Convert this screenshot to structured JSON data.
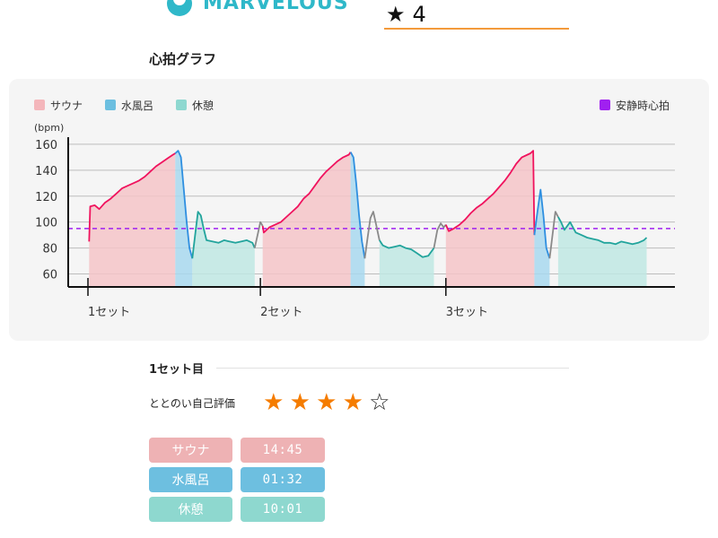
{
  "header": {
    "brand": "MARVELOUS",
    "rating_value": "4",
    "colors": {
      "brand": "#2fb8c9",
      "rating_underline": "#f39a3b"
    }
  },
  "graph_title": "心拍グラフ",
  "chart_data": {
    "type": "area",
    "ylabel": "(bpm)",
    "ylim": [
      50,
      162
    ],
    "yticks": [
      60,
      80,
      100,
      120,
      140,
      160
    ],
    "grid": true,
    "x_range": [
      0,
      100
    ],
    "set_labels": [
      {
        "x": 0,
        "label": "1セット"
      },
      {
        "x": 30.4,
        "label": "2セット"
      },
      {
        "x": 63.1,
        "label": "3セット"
      }
    ],
    "legend": [
      {
        "name": "サウナ",
        "color": "#f4b6bb"
      },
      {
        "name": "水風呂",
        "color": "#6cbfe0"
      },
      {
        "name": "休憩",
        "color": "#8ed8d0"
      }
    ],
    "resting_hr": {
      "name": "安静時心拍",
      "value": 95,
      "color": "#a020f0"
    },
    "segments": [
      {
        "phase": "sauna",
        "points": [
          [
            0.2,
            85
          ],
          [
            0.4,
            112
          ],
          [
            1.2,
            113
          ],
          [
            2,
            110
          ],
          [
            3,
            115
          ],
          [
            4,
            118
          ],
          [
            5,
            122
          ],
          [
            6,
            126
          ],
          [
            7,
            128
          ],
          [
            8,
            130
          ],
          [
            9,
            132
          ],
          [
            10,
            135
          ],
          [
            11,
            139
          ],
          [
            12,
            143
          ],
          [
            13,
            146
          ],
          [
            14,
            149
          ],
          [
            15,
            152
          ],
          [
            15.4,
            153
          ]
        ]
      },
      {
        "phase": "cold",
        "points": [
          [
            15.4,
            153
          ],
          [
            15.9,
            155
          ],
          [
            16.4,
            150
          ],
          [
            16.9,
            125
          ],
          [
            17.4,
            100
          ],
          [
            17.9,
            80
          ],
          [
            18.4,
            72
          ]
        ]
      },
      {
        "phase": "rest",
        "points": [
          [
            18.4,
            72
          ],
          [
            18.9,
            90
          ],
          [
            19.4,
            108
          ],
          [
            19.9,
            105
          ],
          [
            20.4,
            95
          ],
          [
            20.9,
            86
          ],
          [
            22,
            85
          ],
          [
            23,
            84
          ],
          [
            24,
            86
          ],
          [
            25,
            85
          ],
          [
            26,
            84
          ],
          [
            27,
            85
          ],
          [
            28,
            86
          ],
          [
            29,
            84
          ],
          [
            29.4,
            80
          ]
        ]
      },
      {
        "phase": "transition",
        "points": [
          [
            29.4,
            80
          ],
          [
            29.9,
            90
          ],
          [
            30.4,
            100
          ],
          [
            30.8,
            97
          ]
        ]
      },
      {
        "phase": "sauna",
        "points": [
          [
            30.8,
            97
          ],
          [
            31,
            92
          ],
          [
            32,
            96
          ],
          [
            33,
            98
          ],
          [
            34,
            100
          ],
          [
            35,
            104
          ],
          [
            36,
            108
          ],
          [
            37,
            112
          ],
          [
            38,
            118
          ],
          [
            39,
            122
          ],
          [
            40,
            128
          ],
          [
            41,
            134
          ],
          [
            42,
            139
          ],
          [
            43,
            143
          ],
          [
            44,
            147
          ],
          [
            45,
            150
          ],
          [
            46,
            152
          ],
          [
            46.3,
            154
          ]
        ]
      },
      {
        "phase": "cold",
        "points": [
          [
            46.3,
            154
          ],
          [
            46.8,
            150
          ],
          [
            47.3,
            130
          ],
          [
            47.8,
            105
          ],
          [
            48.3,
            85
          ],
          [
            48.8,
            72
          ]
        ]
      },
      {
        "phase": "transition",
        "points": [
          [
            48.8,
            72
          ],
          [
            49.3,
            88
          ],
          [
            49.8,
            103
          ],
          [
            50.3,
            108
          ],
          [
            50.8,
            98
          ],
          [
            51.4,
            86
          ]
        ]
      },
      {
        "phase": "rest",
        "points": [
          [
            51.4,
            86
          ],
          [
            52,
            82
          ],
          [
            53,
            80
          ],
          [
            54,
            81
          ],
          [
            55,
            82
          ],
          [
            56,
            80
          ],
          [
            57,
            79
          ],
          [
            58,
            76
          ],
          [
            59,
            73
          ],
          [
            60,
            74
          ],
          [
            61,
            80
          ]
        ]
      },
      {
        "phase": "transition",
        "points": [
          [
            61,
            80
          ],
          [
            61.6,
            94
          ],
          [
            62.2,
            99
          ],
          [
            62.7,
            96
          ],
          [
            63.1,
            98
          ]
        ]
      },
      {
        "phase": "sauna",
        "points": [
          [
            63.1,
            98
          ],
          [
            63.6,
            93
          ],
          [
            64.5,
            95
          ],
          [
            65.5,
            98
          ],
          [
            66.5,
            102
          ],
          [
            67.5,
            107
          ],
          [
            68.5,
            111
          ],
          [
            69.5,
            114
          ],
          [
            70.5,
            118
          ],
          [
            71.5,
            122
          ],
          [
            72.5,
            127
          ],
          [
            73.5,
            132
          ],
          [
            74.5,
            138
          ],
          [
            75.5,
            145
          ],
          [
            76.5,
            150
          ],
          [
            77.5,
            152
          ],
          [
            78,
            153
          ],
          [
            78.5,
            155
          ],
          [
            78.7,
            90
          ]
        ]
      },
      {
        "phase": "cold",
        "points": [
          [
            78.7,
            90
          ],
          [
            79.3,
            110
          ],
          [
            79.8,
            125
          ],
          [
            80.3,
            105
          ],
          [
            80.8,
            80
          ],
          [
            81.4,
            72
          ]
        ]
      },
      {
        "phase": "transition",
        "points": [
          [
            81.4,
            72
          ],
          [
            81.9,
            90
          ],
          [
            82.4,
            108
          ],
          [
            82.9,
            104
          ]
        ]
      },
      {
        "phase": "rest",
        "points": [
          [
            82.9,
            104
          ],
          [
            83.4,
            100
          ],
          [
            84,
            94
          ],
          [
            85,
            100
          ],
          [
            86,
            92
          ],
          [
            87,
            90
          ],
          [
            88,
            88
          ],
          [
            89,
            87
          ],
          [
            90,
            86
          ],
          [
            91,
            84
          ],
          [
            92,
            84
          ],
          [
            93,
            83
          ],
          [
            94,
            85
          ],
          [
            95,
            84
          ],
          [
            96,
            83
          ],
          [
            97,
            84
          ],
          [
            98,
            86
          ],
          [
            98.5,
            88
          ]
        ]
      }
    ],
    "colors": {
      "sauna_line": "#f0135e",
      "sauna_fill": "#f4c4c8",
      "cold_line": "#2f8fe0",
      "cold_fill": "#a8d8ee",
      "rest_line": "#22a49c",
      "rest_fill": "#bfe8e3",
      "transition_line": "#8a8a8a"
    }
  },
  "set_detail": {
    "title": "1セット目",
    "self_rating_label": "ととのい自己評価",
    "self_rating": 4,
    "max_rating": 5,
    "phases": [
      {
        "name": "サウナ",
        "time": "14:45",
        "color": "#eeb2b4"
      },
      {
        "name": "水風呂",
        "time": "01:32",
        "color": "#6dbfe0"
      },
      {
        "name": "休憩",
        "time": "10:01",
        "color": "#8ed8cf"
      }
    ]
  }
}
